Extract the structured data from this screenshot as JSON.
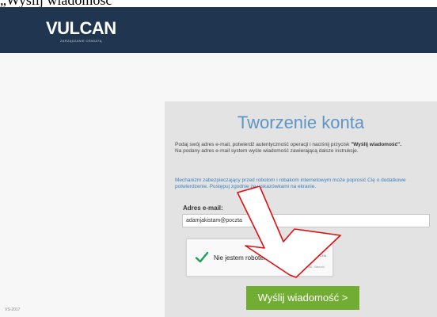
{
  "top_caption": "„Wyślij wiadomość”",
  "header": {
    "logo_text": "VULCAN",
    "logo_subtitle": "ZARZĄDZANIE OŚWIATĄ",
    "bg_color": "#1f3550"
  },
  "form": {
    "title": "Tworzenie konta",
    "instructions_before": "Podaj swój adres e-mail, potwierdź autentyczność operacji i naciśnij przycisk ",
    "instructions_bold": "\"Wyślij wiadomość\".",
    "instructions_after": "Na podany adres e-mail system wyśle wiadomość zawierającą dalsze instrukcje.",
    "mechanism_text": "Mechanizm zabezpieczający przed robotom i robakom internetowym może poprosić Cię o dodatkowe potwierdzenie. Postępuj zgodnie ze wskazówkami na ekranie.",
    "email_label": "Adres e-mail:",
    "email_value": "adamjakistam@poczta",
    "captcha": {
      "label": "Nie jestem robotem",
      "brand": "reCAPTCHA",
      "brand_sub": "Prywatność - Warunki",
      "checked": true,
      "check_color": "#1aa05a"
    },
    "submit_label": "Wyślij wiadomość >",
    "submit_color": "#72ad33"
  },
  "footer": {
    "text": "VS-2017"
  },
  "annotation": {
    "type": "arrow",
    "direction": "down-right",
    "stroke_color": "#e01010"
  }
}
